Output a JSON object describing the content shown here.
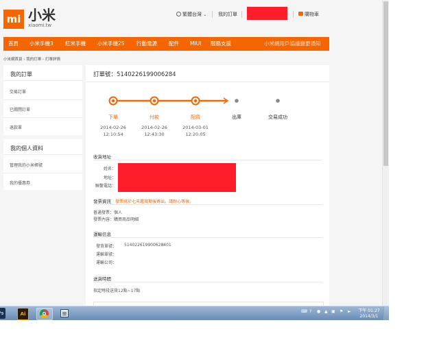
{
  "brand": {
    "logo_mark": "mi",
    "name_cn": "小米",
    "name_en": "xiaomi.tw"
  },
  "topbar": {
    "language": "繁體台灣",
    "my_orders": "我的訂單",
    "cart": "購物車"
  },
  "nav": {
    "items": [
      "首頁",
      "小米手機3",
      "紅米手機",
      "小米手機2S",
      "行動電源",
      "配件",
      "MIUI",
      "服務支援"
    ],
    "promo": "小米網用戶協議變更通知"
  },
  "breadcrumb": {
    "home": "小米網首頁",
    "orders": "我的訂單",
    "current": "訂單詳情"
  },
  "sidebar": {
    "orders_title": "我的訂單",
    "order_items": [
      "交易訂單",
      "已關閉訂單",
      "退款單"
    ],
    "profile_title": "我的個人資料",
    "profile_items": [
      "管理我的小米帳號",
      "我的優惠券"
    ]
  },
  "order": {
    "label": "訂單號：",
    "number": "5140226199006284",
    "progress": [
      {
        "name": "下單",
        "date": "2014-02-26",
        "time": "12:10:54",
        "done": true
      },
      {
        "name": "付款",
        "date": "2014-02-26",
        "time": "12:43:30",
        "done": true
      },
      {
        "name": "配貨",
        "date": "2014-03-01",
        "time": "12:20:05",
        "done": true
      },
      {
        "name": "出庫",
        "date": "",
        "time": "",
        "done": false
      },
      {
        "name": "交易成功",
        "date": "",
        "time": "",
        "done": false
      }
    ]
  },
  "address": {
    "heading": "收貨地址",
    "name_label": "姓名：",
    "addr_label": "地址：",
    "phone_label": "聯繫電話："
  },
  "invoice": {
    "heading": "發票資訊",
    "notice": "發票將於七天鑑賞期後寄出，請耐心等候。",
    "type_line": "普通發票：個人",
    "content_line": "發票內容：購買商品明細"
  },
  "shipping": {
    "heading": "運輸信息",
    "invoice_no_label": "發貨單號：",
    "invoice_no": "514022619900628401",
    "tracking_label": "運輸單號：",
    "carrier_label": "運輸公司："
  },
  "delivery": {
    "heading": "送貨時間",
    "text": "指定時段送貨12點~17點"
  },
  "taskbar": {
    "ps_label": "Ps",
    "ai_label": "Ai",
    "time": "下午 01:27",
    "date": "2014/3/1"
  },
  "colors": {
    "accent": "#f56600",
    "redaction": "#ff1c2b"
  }
}
